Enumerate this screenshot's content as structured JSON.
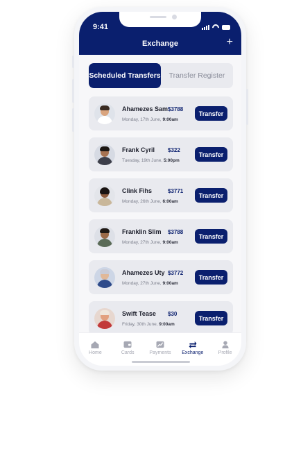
{
  "status_bar": {
    "time": "9:41"
  },
  "header": {
    "title": "Exchange",
    "add_label": "+"
  },
  "segments": [
    {
      "label": "Scheduled Transfers",
      "active": true
    },
    {
      "label": "Transfer Register",
      "active": false
    }
  ],
  "transfers": [
    {
      "name": "Ahamezes Sam",
      "amount": "$3788",
      "date": "Monday, 17th June,",
      "time": "9:00am",
      "button": "Transfer"
    },
    {
      "name": "Frank Cyril",
      "amount": "$322",
      "date": "Tuesday, 19th June,",
      "time": "5:00pm",
      "button": "Transfer"
    },
    {
      "name": "Clink Fihs",
      "amount": "$3771",
      "date": "Monday, 26th June,",
      "time": "6:00am",
      "button": "Transfer"
    },
    {
      "name": "Franklin Slim",
      "amount": "$3788",
      "date": "Monday, 27th June,",
      "time": "9:00am",
      "button": "Transfer"
    },
    {
      "name": "Ahamezes Uty",
      "amount": "$3772",
      "date": "Monday, 27th June,",
      "time": "9:00am",
      "button": "Transfer"
    },
    {
      "name": "Swift Tease",
      "amount": "$30",
      "date": "Friday, 30th June,",
      "time": "9:00am",
      "button": "Transfer"
    }
  ],
  "tabbar": [
    {
      "label": "Home",
      "icon": "home-icon",
      "active": false
    },
    {
      "label": "Cards",
      "icon": "card-icon",
      "active": false
    },
    {
      "label": "Payments",
      "icon": "payments-icon",
      "active": false
    },
    {
      "label": "Exchange",
      "icon": "exchange-icon",
      "active": true
    },
    {
      "label": "Profile",
      "icon": "profile-icon",
      "active": false
    }
  ],
  "colors": {
    "primary": "#0a1f6e",
    "card": "#e9eaef",
    "inactive": "#a6a8b3"
  }
}
